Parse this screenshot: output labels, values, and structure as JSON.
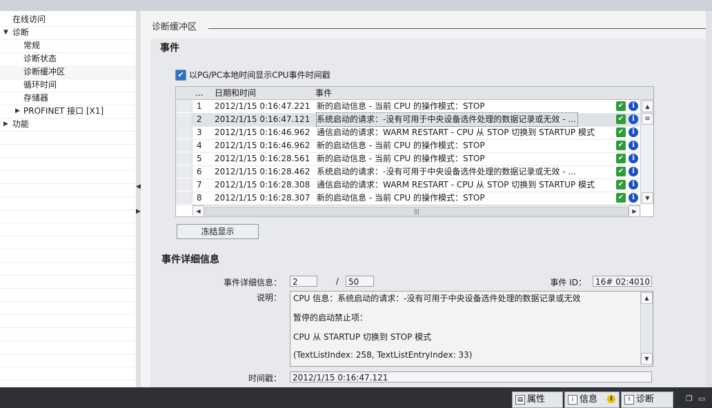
{
  "tree": {
    "items": [
      {
        "label": "在线访问",
        "level": 0,
        "expander": ""
      },
      {
        "label": "诊断",
        "level": 0,
        "expander": "expanded"
      },
      {
        "label": "常规",
        "level": 1,
        "expander": ""
      },
      {
        "label": "诊断状态",
        "level": 1,
        "expander": ""
      },
      {
        "label": "诊断缓冲区",
        "level": 1,
        "expander": "",
        "selected": true
      },
      {
        "label": "循环时间",
        "level": 1,
        "expander": ""
      },
      {
        "label": "存储器",
        "level": 1,
        "expander": ""
      },
      {
        "label": "PROFINET 接口 [X1]",
        "level": 1,
        "expander": "collapsed"
      },
      {
        "label": "功能",
        "level": 0,
        "expander": "collapsed"
      }
    ]
  },
  "section": {
    "title": "诊断缓冲区"
  },
  "events": {
    "heading": "事件",
    "checkbox_label": "以PG/PC本地时间显示CPU事件时间戳",
    "checkbox_checked": true,
    "columns": [
      "...",
      "日期和时间",
      "事件"
    ],
    "rows": [
      {
        "no": "1",
        "time": "2012/1/15 0:16:47.221",
        "event": "新的启动信息 - 当前 CPU 的操作模式：STOP"
      },
      {
        "no": "2",
        "time": "2012/1/15 0:16:47.121",
        "event": "系统启动的请求：-没有可用于中央设备选件处理的数据记录或无效 - ..."
      },
      {
        "no": "3",
        "time": "2012/1/15 0:16:46.962",
        "event": "通信启动的请求：WARM RESTART - CPU 从 STOP 切换到 STARTUP 模式"
      },
      {
        "no": "4",
        "time": "2012/1/15 0:16:46.962",
        "event": "新的启动信息 - 当前 CPU 的操作模式：STOP"
      },
      {
        "no": "5",
        "time": "2012/1/15 0:16:28.561",
        "event": "新的启动信息 - 当前 CPU 的操作模式：STOP"
      },
      {
        "no": "6",
        "time": "2012/1/15 0:16:28.462",
        "event": "系统启动的请求：-没有可用于中央设备选件处理的数据记录或无效 - ..."
      },
      {
        "no": "7",
        "time": "2012/1/15 0:16:28.308",
        "event": "通信启动的请求：WARM RESTART - CPU 从 STOP 切换到 STARTUP 模式"
      },
      {
        "no": "8",
        "time": "2012/1/15 0:16:28.307",
        "event": "新的启动信息 - 当前 CPU 的操作模式：STOP"
      }
    ],
    "selected_row": 2,
    "freeze_button": "冻结显示",
    "hscroll_grip": "|||"
  },
  "detail": {
    "heading": "事件详细信息",
    "detail_label": "事件详细信息：",
    "detail_index": "2",
    "separator": "/",
    "detail_total": "50",
    "event_id_label": "事件 ID：",
    "event_id": "16# 02:4010",
    "desc_label": "说明：",
    "desc_lines": [
      "CPU 信息：系统启动的请求：-没有可用于中央设备选件处理的数据记录或无效",
      "暂停的启动禁止项：",
      " CPU 从 STARTUP 切换到 STOP 模式",
      " (TextListIndex: 258, TextListEntryIndex: 33)"
    ],
    "timestamp_label": "时间戳：",
    "timestamp": "2012/1/15 0:16:47.121"
  },
  "statusbar": {
    "properties": "属性",
    "info": "信息",
    "diagnostics": "诊断"
  },
  "colors": {
    "ok": "#2f9b39",
    "info": "#1b51c4",
    "status_bg": "#2e3035"
  }
}
